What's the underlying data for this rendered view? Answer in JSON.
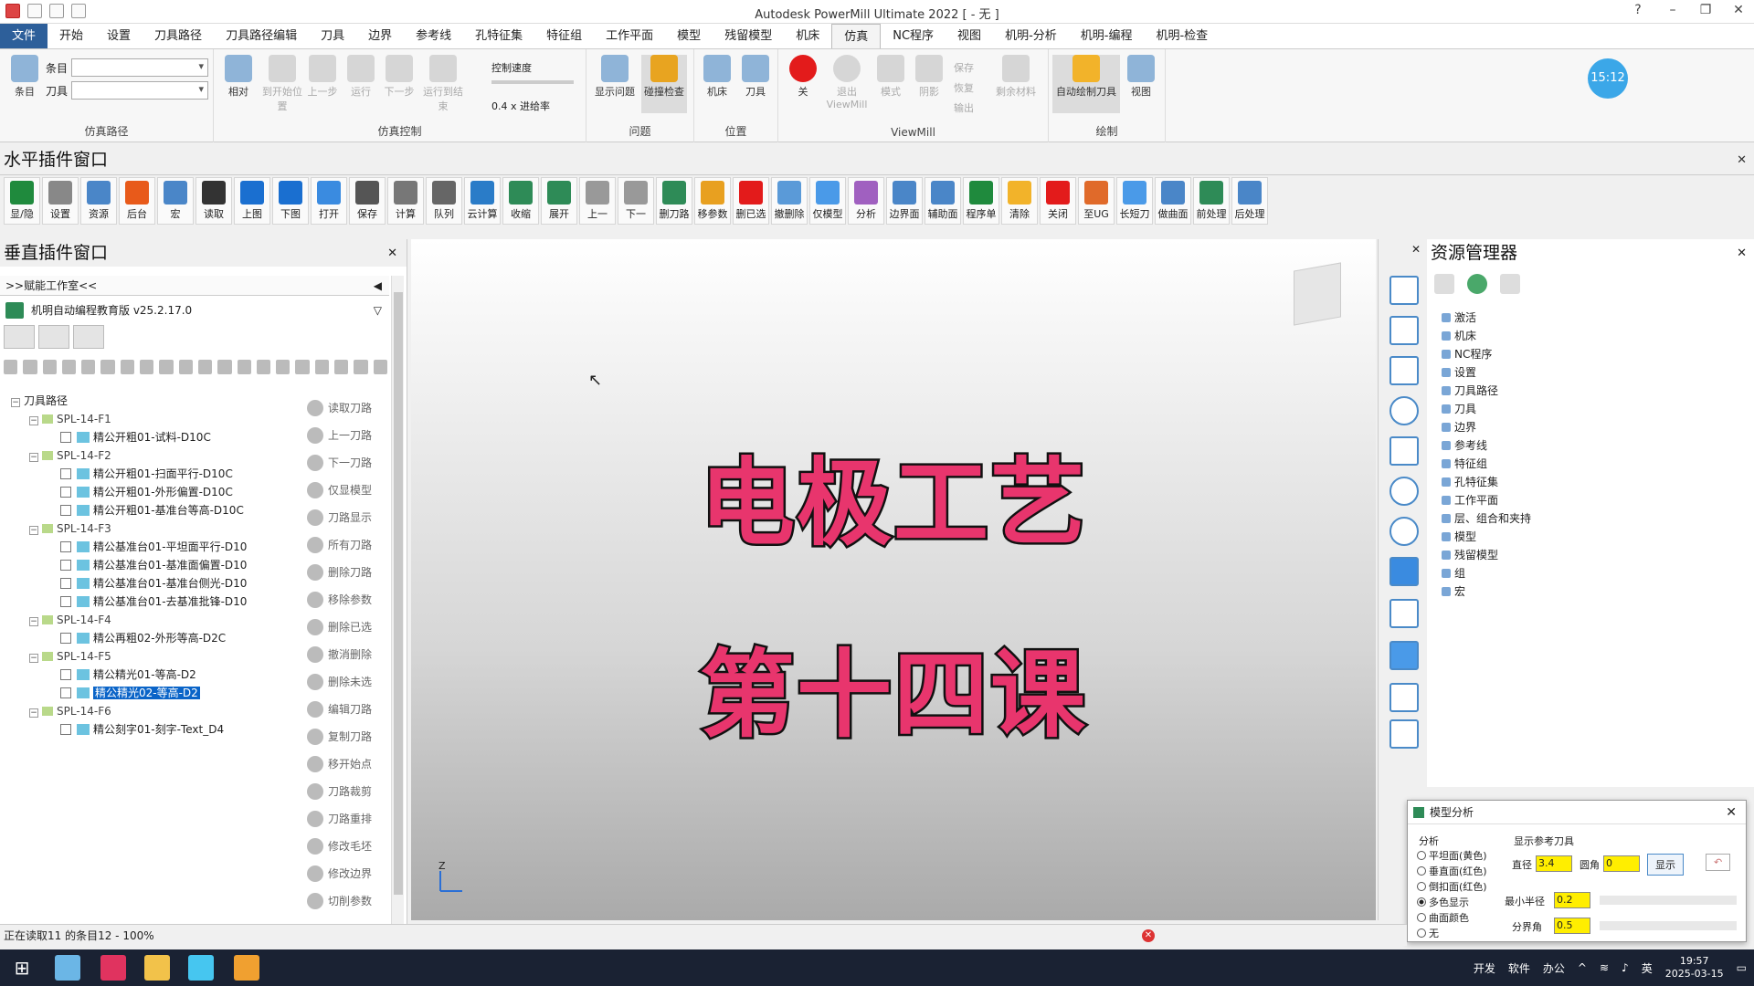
{
  "window": {
    "title": "Autodesk PowerMill Ultimate 2022   [ - 无 ]"
  },
  "menu": [
    "文件",
    "开始",
    "设置",
    "刀具路径",
    "刀具路径编辑",
    "刀具",
    "边界",
    "参考线",
    "孔特征集",
    "特征组",
    "工作平面",
    "模型",
    "残留模型",
    "机床",
    "仿真",
    "NC程序",
    "视图",
    "机明-分析",
    "机明-编程",
    "机明-检查"
  ],
  "menu_active": "仿真",
  "ribbon": {
    "sim_path": {
      "label": "仿真路径",
      "item_label": "条目",
      "tool_label": "刀具",
      "btn": "条目"
    },
    "sim_control": {
      "label": "仿真控制",
      "buttons": [
        "相对",
        "到开始位置",
        "上一步",
        "运行",
        "下一步",
        "运行到结束"
      ],
      "speed_label": "控制速度",
      "rate": "0.4 x 进给率"
    },
    "problems": {
      "label": "问题",
      "buttons": [
        "显示问题",
        "碰撞检查"
      ]
    },
    "position": {
      "label": "位置",
      "buttons": [
        "机床",
        "刀具"
      ]
    },
    "viewmill": {
      "label": "ViewMill",
      "buttons": [
        "关",
        "退出 ViewMill",
        "模式",
        "阴影"
      ],
      "small": [
        "保存",
        "恢复",
        "输出"
      ],
      "extra": "剩余材料"
    },
    "draw": {
      "label": "绘制",
      "buttons": [
        "自动绘制刀具",
        "视图"
      ]
    }
  },
  "clock_badge": "15:12",
  "hplugin": {
    "title": "水平插件窗口"
  },
  "toolbar2": [
    "显/隐",
    "设置",
    "资源",
    "后台",
    "宏",
    "读取",
    "上图",
    "下图",
    "打开",
    "保存",
    "计算",
    "队列",
    "云计算",
    "收缩",
    "展开",
    "上一",
    "下一",
    "删刀路",
    "移参数",
    "删已选",
    "撤删除",
    "仅模型",
    "分析",
    "边界面",
    "辅助面",
    "程序单",
    "清除",
    "关闭",
    "至UG",
    "长短刀",
    "做曲面",
    "前处理",
    "后处理"
  ],
  "vplugin": {
    "title": "垂直插件窗口",
    "studio": ">>赋能工作室<<",
    "version": "机明自动编程教育版 v25.2.17.0"
  },
  "tree": {
    "root": "刀具路径",
    "groups": [
      {
        "name": "SPL-14-F1",
        "items": [
          "精公开粗01-试料-D10C"
        ]
      },
      {
        "name": "SPL-14-F2",
        "items": [
          "精公开粗01-扫面平行-D10C",
          "精公开粗01-外形偏置-D10C",
          "精公开粗01-基准台等高-D10C"
        ]
      },
      {
        "name": "SPL-14-F3",
        "items": [
          "精公基准台01-平坦面平行-D10",
          "精公基准台01-基准面偏置-D10",
          "精公基准台01-基准台侧光-D10",
          "精公基准台01-去基准批锋-D10"
        ]
      },
      {
        "name": "SPL-14-F4",
        "items": [
          "精公再粗02-外形等高-D2C"
        ]
      },
      {
        "name": "SPL-14-F5",
        "items": [
          "精公精光01-等高-D2",
          "精公精光02-等高-D2"
        ]
      },
      {
        "name": "SPL-14-F6",
        "items": [
          "精公刻字01-刻字-Text_D4"
        ]
      }
    ],
    "selected": "精公精光02-等高-D2"
  },
  "ops": [
    "读取刀路",
    "上一刀路",
    "下一刀路",
    "仅显模型",
    "刀路显示",
    "所有刀路",
    "删除刀路",
    "移除参数",
    "删除已选",
    "撤消删除",
    "删除未选",
    "编辑刀路",
    "复制刀路",
    "移开始点",
    "刀路裁剪",
    "刀路重排",
    "修改毛坯",
    "修改边界",
    "切削参数"
  ],
  "viewport": {
    "line1": "电极工艺",
    "line2": "第十四课",
    "axis": "Z"
  },
  "resource": {
    "title": "资源管理器",
    "items": [
      "激活",
      "机床",
      "NC程序",
      "设置",
      "刀具路径",
      "刀具",
      "边界",
      "参考线",
      "特征组",
      "孔特征集",
      "工作平面",
      "层、组合和夹持",
      "模型",
      "残留模型",
      "组",
      "宏"
    ]
  },
  "dialog": {
    "title": "模型分析",
    "analysis_label": "分析",
    "options": [
      "平坦面(黄色)",
      "垂直面(红色)",
      "倒扣面(红色)",
      "多色显示",
      "曲面颜色",
      "无"
    ],
    "selected": "多色显示",
    "ref_label": "显示参考刀具",
    "dia_label": "直径",
    "dia": "3.4",
    "corner_label": "圆角",
    "corner": "0",
    "show_btn": "显示",
    "minr_label": "最小半径",
    "minr": "0.2",
    "split_label": "分界角",
    "split": "0.5"
  },
  "status": "正在读取11 的条目12 - 100%",
  "taskbar": {
    "tray": [
      "开发",
      "软件",
      "办公"
    ],
    "ime": "英",
    "time": "19:57",
    "date": "2025-03-15"
  }
}
